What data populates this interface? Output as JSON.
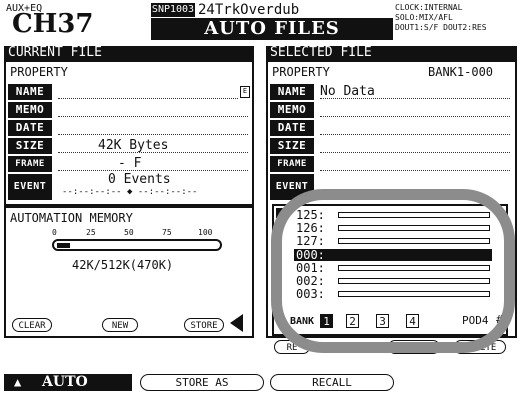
{
  "header": {
    "channel_small": "AUX+EQ",
    "channel": "CH37",
    "mode_badge": "SNP1003",
    "project_name": "24TrkOverdub",
    "screen_title": "AUTO FILES",
    "status_lines": [
      "CLOCK:INTERNAL",
      "SOLO:MIX/AFL",
      "DOUT1:S/F  DOUT2:RES"
    ]
  },
  "current_file": {
    "title": "CURRENT FILE",
    "property_label": "PROPERTY",
    "fields": [
      {
        "label": "NAME",
        "value": ""
      },
      {
        "label": "MEMO",
        "value": ""
      },
      {
        "label": "DATE",
        "value": ""
      },
      {
        "label": "SIZE",
        "value": "42K Bytes"
      },
      {
        "label": "FRAME",
        "value": "- F"
      },
      {
        "label": "EVENT",
        "value": "0 Events"
      }
    ],
    "event_timecode": "--:--:--:-- ◆ --:--:--:--",
    "name_edit_icon": "edit-icon"
  },
  "automation_memory": {
    "title": "AUTOMATION MEMORY",
    "scale": [
      "0",
      "25",
      "50",
      "75",
      "100"
    ],
    "usage_fraction": 0.08,
    "readout": "42K/512K(470K)"
  },
  "current_buttons": {
    "clear": "CLEAR",
    "new": "NEW",
    "store": "STORE"
  },
  "selected_file": {
    "title": "SELECTED FILE",
    "property_label": "PROPERTY",
    "bank_label": "BANK1-000",
    "fields": [
      {
        "label": "NAME",
        "value": "No Data"
      },
      {
        "label": "MEMO",
        "value": ""
      },
      {
        "label": "DATE",
        "value": ""
      },
      {
        "label": "SIZE",
        "value": ""
      },
      {
        "label": "FRAME",
        "value": ""
      },
      {
        "label": "EVENT",
        "value": ""
      }
    ]
  },
  "file_list": {
    "rows": [
      {
        "num": "125:",
        "selected": false
      },
      {
        "num": "126:",
        "selected": false
      },
      {
        "num": "127:",
        "selected": false
      },
      {
        "num": "000:",
        "selected": true
      },
      {
        "num": "001:",
        "selected": false
      },
      {
        "num": "002:",
        "selected": false
      },
      {
        "num": "003:",
        "selected": false
      }
    ],
    "bank_word": "BANK",
    "banks": [
      "1",
      "2",
      "3",
      "4"
    ],
    "active_bank": "1",
    "pod_label": "POD4"
  },
  "selected_buttons": {
    "recall": "RE",
    "protect": "PROTECT",
    "delete": "DELETE"
  },
  "bottom_tabs": {
    "auto": "AUTO",
    "store_as": "STORE AS",
    "recall": "RECALL"
  },
  "colors": {
    "ink": "#111111",
    "paper": "#ffffff",
    "highlight_ring": "#8c8c8c"
  }
}
